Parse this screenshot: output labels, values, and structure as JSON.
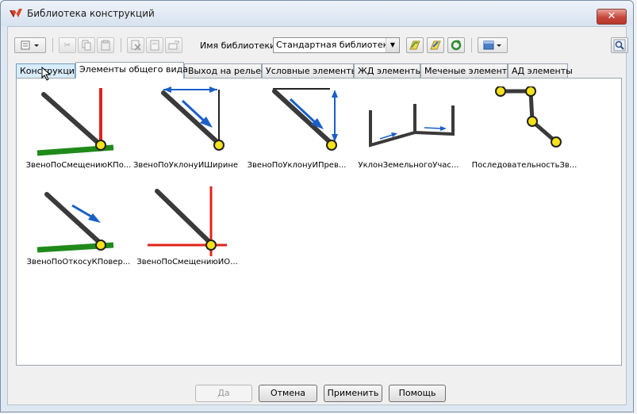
{
  "window": {
    "title": "Библиотека конструкций",
    "close_label": "✕"
  },
  "toolbar": {
    "library_label": "Имя библиотеки:",
    "library_value": "Стандартная библиотека"
  },
  "tabs": [
    {
      "label": "Конструкции"
    },
    {
      "label": "Элементы общего вида"
    },
    {
      "label": "Выход на рельеф"
    },
    {
      "label": "Условные элементы"
    },
    {
      "label": "ЖД элементы"
    },
    {
      "label": "Меченые элементы"
    },
    {
      "label": "АД элементы"
    }
  ],
  "items": [
    {
      "label": "ЗвеноПоСмещениюКПо...",
      "icon": "offset-link-icon"
    },
    {
      "label": "ЗвеноПоУклонуИШирине",
      "icon": "slope-width-link-icon"
    },
    {
      "label": "ЗвеноПоУклонуИПрев...",
      "icon": "slope-height-link-icon"
    },
    {
      "label": "УклонЗемельногоУчас...",
      "icon": "land-slope-icon"
    },
    {
      "label": "ПоследовательностьЗв...",
      "icon": "link-sequence-icon"
    },
    {
      "label": "ЗвеноПоОткосуКПовер...",
      "icon": "slope-to-surface-icon"
    },
    {
      "label": "ЗвеноПоСмещениюИО...",
      "icon": "offset-elevation-icon"
    }
  ],
  "buttons": {
    "ok": "Да",
    "cancel": "Отмена",
    "apply": "Применить",
    "help": "Помощь"
  },
  "colors": {
    "red": "#e0231b",
    "green": "#1f8a1a",
    "blue": "#1a5fc7",
    "yellow": "#f5e21a",
    "dark": "#3a3a3a"
  }
}
